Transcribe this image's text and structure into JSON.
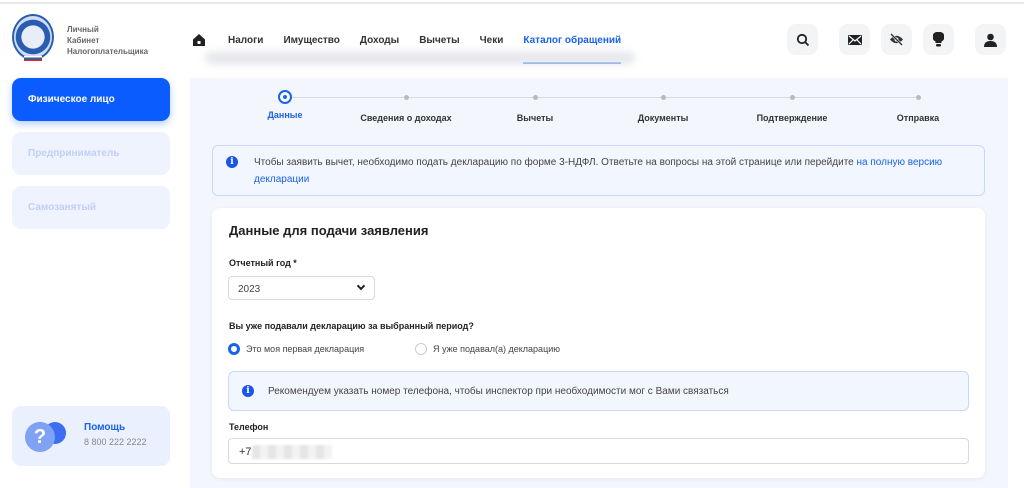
{
  "brand": {
    "line1": "Личный",
    "line2": "Кабинет",
    "line3": "Налогоплательщика"
  },
  "nav": {
    "items": [
      "Налоги",
      "Имущество",
      "Доходы",
      "Вычеты",
      "Чеки"
    ],
    "active": "Каталог обращений"
  },
  "header_icons": [
    "search-icon",
    "mail-icon",
    "eye-off-icon",
    "lightbulb-icon",
    "user-icon"
  ],
  "sidebar": {
    "items": [
      "Физическое лицо",
      "Предприниматель",
      "Самозанятый"
    ],
    "help_title": "Помощь",
    "help_phone": "8 800 222 2222"
  },
  "stepper": {
    "steps": [
      "Данные",
      "Сведения о доходах",
      "Вычеты",
      "Документы",
      "Подтверждение",
      "Отправка"
    ],
    "current": 0
  },
  "notice": {
    "text": "Чтобы заявить вычет, необходимо подать декларацию по форме 3-НДФЛ. Ответьте на вопросы на этой странице или перейдите ",
    "link": "на полную версию декларации"
  },
  "form": {
    "title": "Данные для подачи заявления",
    "year_label": "Отчетный год *",
    "year_value": "2023",
    "question": "Вы уже подавали декларацию за выбранный период?",
    "radio_first": "Это моя первая декларация",
    "radio_second": "Я уже подавал(а) декларацию",
    "phone_tip": "Рекомендуем указать номер телефона, чтобы инспектор при необходимости мог с Вами связаться",
    "phone_label": "Телефон",
    "phone_prefix": "+7"
  },
  "colors": {
    "accent": "#0a5cff",
    "link": "#1a62e8"
  }
}
